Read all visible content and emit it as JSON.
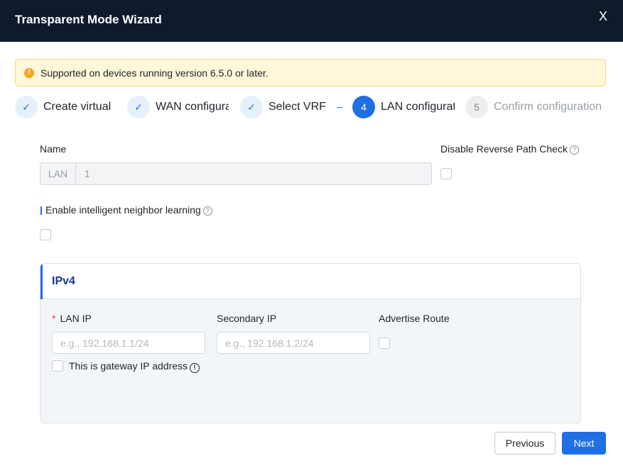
{
  "dialog": {
    "title": "Transparent Mode Wizard",
    "close_glyph": "X"
  },
  "alert": {
    "icon": "warning-icon",
    "icon_glyph": "!",
    "text": "Supported on devices running version 6.5.0 or later."
  },
  "steps": [
    {
      "status": "done",
      "glyph": "✓",
      "label": "Create virtual"
    },
    {
      "status": "done",
      "glyph": "✓",
      "label": "WAN configuration"
    },
    {
      "status": "done",
      "glyph": "✓",
      "label": "Select VRF"
    },
    {
      "status": "active",
      "glyph": "4",
      "label": "LAN configuration"
    },
    {
      "status": "pending",
      "glyph": "5",
      "label": "Confirm configuration"
    }
  ],
  "form": {
    "name_label": "Name",
    "name_prefix": "LAN",
    "name_value": "1",
    "reverse_path_label": "Disable Reverse Path Check",
    "neighbor_learning_label": "Enable intelligent neighbor learning",
    "help_glyph": "?"
  },
  "ipv4": {
    "title": "IPv4",
    "lan_ip_label": "LAN IP",
    "required_mark": "*",
    "lan_ip_placeholder": "e.g., 192.168.1.1/24",
    "secondary_ip_label": "Secondary IP",
    "secondary_ip_placeholder": "e.g., 192.168.1.2/24",
    "advertise_route_label": "Advertise Route",
    "gateway_label": "This is gateway IP address",
    "info_glyph": "!"
  },
  "footer": {
    "previous_label": "Previous",
    "next_label": "Next"
  },
  "colors": {
    "header_bg": "#0f1b2d",
    "primary": "#1f6fe5",
    "warning_bg": "#fff7d9"
  }
}
